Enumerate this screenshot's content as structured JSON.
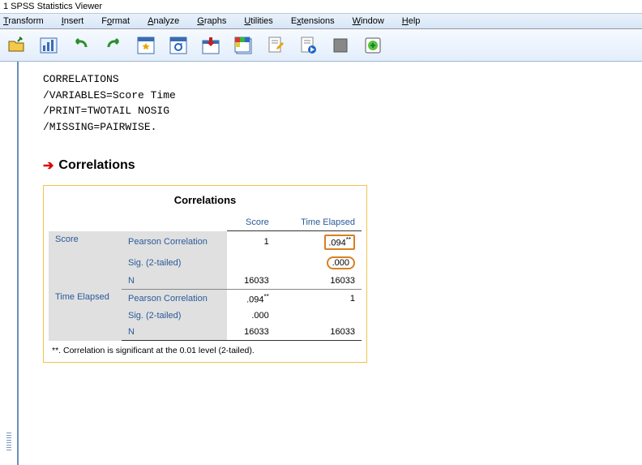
{
  "window": {
    "title": "1 SPSS Statistics Viewer"
  },
  "menu": {
    "transform": "Transform",
    "insert": "Insert",
    "format": "Format",
    "analyze": "Analyze",
    "graphs": "Graphs",
    "utilities": "Utilities",
    "extensions": "Extensions",
    "window": "Window",
    "help": "Help"
  },
  "syntax": {
    "l1": "CORRELATIONS",
    "l2": "  /VARIABLES=Score Time",
    "l3": "  /PRINT=TWOTAIL NOSIG",
    "l4": "  /MISSING=PAIRWISE."
  },
  "heading": "Correlations",
  "table": {
    "title": "Correlations",
    "col1": "Score",
    "col2": "Time Elapsed",
    "rowvar1": "Score",
    "rowvar2": "Time Elapsed",
    "stat_pearson": "Pearson Correlation",
    "stat_sig": "Sig. (2-tailed)",
    "stat_n": "N",
    "r11": "1",
    "r12": ".094",
    "r12s": "**",
    "s12": ".000",
    "n1a": "16033",
    "n1b": "16033",
    "r21": ".094",
    "r21s": "**",
    "r22": "1",
    "s21": ".000",
    "n2a": "16033",
    "n2b": "16033",
    "note": "**. Correlation is significant at the 0.01 level (2-tailed)."
  }
}
